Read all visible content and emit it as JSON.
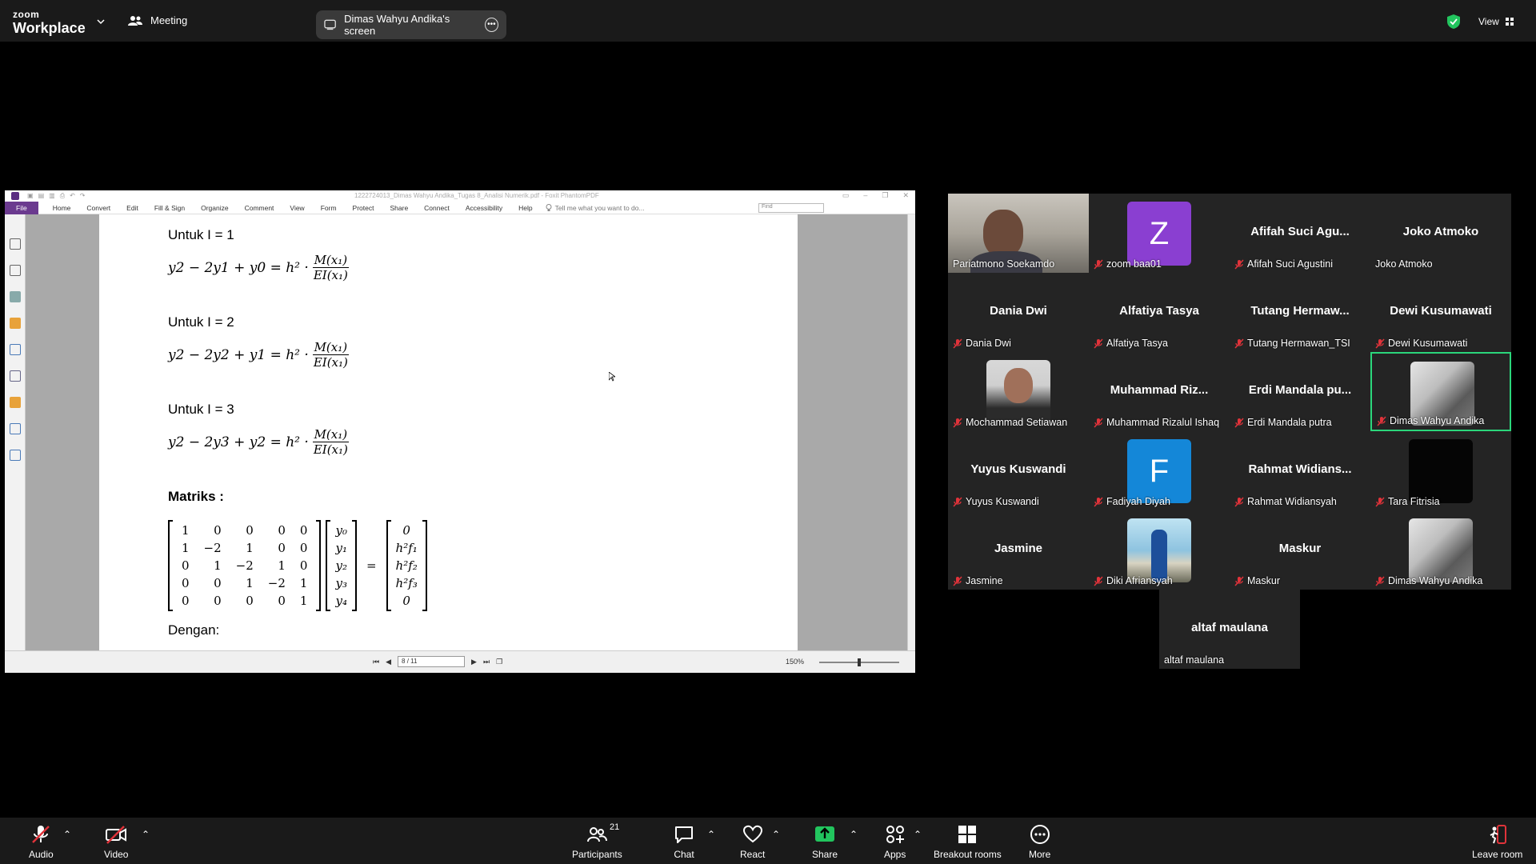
{
  "app": {
    "brand_small": "zoom",
    "brand_big": "Workplace",
    "meeting_label": "Meeting",
    "share_pill": "Dimas Wahyu Andika's screen",
    "view_label": "View"
  },
  "pdf": {
    "window_title": "1222724013_Dimas Wahyu Andika_Tugas 8_Analisi Numerik.pdf - Foxit PhantomPDF",
    "menus": [
      "File",
      "Home",
      "Convert",
      "Edit",
      "Fill & Sign",
      "Organize",
      "Comment",
      "View",
      "Form",
      "Protect",
      "Share",
      "Connect",
      "Accessibility",
      "Help"
    ],
    "tell_me": "Tell me what you want to do...",
    "find_placeholder": "Find",
    "page_indicator": "8 / 11",
    "zoom": "150%",
    "content": {
      "h1": "Untuk I = 1",
      "eq1_lhs": "y2 − 2y1 + y0 = h² ·",
      "h2": "Untuk I = 2",
      "eq2_lhs": "y2 − 2y2 + y1 = h² ·",
      "h3": "Untuk I = 3",
      "eq3_lhs": "y2 − 2y3 + y2 = h² ·",
      "frac_num": "M(x₁)",
      "frac_den": "EI(x₁)",
      "matrix_title": "Matriks :",
      "matrix_A": [
        "1",
        "0",
        "0",
        "0",
        "0",
        "1",
        "−2",
        "1",
        "0",
        "0",
        "0",
        "1",
        "−2",
        "1",
        "0",
        "0",
        "0",
        "1",
        "−2",
        "1",
        "0",
        "0",
        "0",
        "0",
        "1"
      ],
      "vector_y": [
        "y₀",
        "y₁",
        "y₂",
        "y₃",
        "y₄"
      ],
      "equals": "=",
      "vector_rhs": [
        "0",
        "h²f₁",
        "h²f₂",
        "h²f₃",
        "0"
      ],
      "footer_text": "Dengan:"
    }
  },
  "participants": [
    {
      "display": "",
      "label": "Pariatmono Soekamdo",
      "muted": false,
      "kind": "video"
    },
    {
      "display": "Z",
      "label": "zoom baa01",
      "muted": true,
      "kind": "avatar",
      "color": "#8a3fd1"
    },
    {
      "display": "Afifah  Suci  Agu...",
      "label": "Afifah Suci Agustini",
      "muted": true,
      "kind": "name"
    },
    {
      "display": "Joko Atmoko",
      "label": "Joko Atmoko",
      "muted": false,
      "kind": "name"
    },
    {
      "display": "Dania Dwi",
      "label": "Dania Dwi",
      "muted": true,
      "kind": "name"
    },
    {
      "display": "Alfatiya Tasya",
      "label": "Alfatiya Tasya",
      "muted": true,
      "kind": "name"
    },
    {
      "display": "Tutang  Hermaw...",
      "label": "Tutang Hermawan_TSI",
      "muted": true,
      "kind": "name"
    },
    {
      "display": "Dewi Kusumawati",
      "label": "Dewi Kusumawati",
      "muted": true,
      "kind": "name"
    },
    {
      "display": "",
      "label": "Mochammad Setiawan",
      "muted": true,
      "kind": "photo-person"
    },
    {
      "display": "Muhammad  Riz...",
      "label": "Muhammad Rizalul Ishaq",
      "muted": true,
      "kind": "name"
    },
    {
      "display": "Erdi  Mandala  pu...",
      "label": "Erdi Mandala putra",
      "muted": true,
      "kind": "name"
    },
    {
      "display": "",
      "label": "Dimas Wahyu Andika",
      "muted": true,
      "kind": "photo-room",
      "active": true
    },
    {
      "display": "Yuyus Kuswandi",
      "label": "Yuyus Kuswandi",
      "muted": true,
      "kind": "name"
    },
    {
      "display": "F",
      "label": "Fadiyah Diyah",
      "muted": true,
      "kind": "avatar",
      "color": "#1487d8"
    },
    {
      "display": "Rahmat  Widians...",
      "label": "Rahmat Widiansyah",
      "muted": true,
      "kind": "name"
    },
    {
      "display": "",
      "label": "Tara Fitrisia",
      "muted": true,
      "kind": "photo-dark"
    },
    {
      "display": "Jasmine",
      "label": "Jasmine",
      "muted": true,
      "kind": "name"
    },
    {
      "display": "",
      "label": "Diki Afriansyah",
      "muted": true,
      "kind": "photo-outdoor"
    },
    {
      "display": "Maskur",
      "label": "Maskur",
      "muted": true,
      "kind": "name"
    },
    {
      "display": "",
      "label": "Dimas Wahyu Andika",
      "muted": true,
      "kind": "photo-room"
    },
    {
      "display": "altaf maulana",
      "label": "altaf maulana",
      "muted": false,
      "kind": "name"
    }
  ],
  "toolbar": {
    "audio": "Audio",
    "video": "Video",
    "participants": "Participants",
    "participants_count": "21",
    "chat": "Chat",
    "react": "React",
    "share": "Share",
    "apps": "Apps",
    "breakout": "Breakout rooms",
    "more": "More",
    "leave": "Leave room"
  },
  "colors": {
    "accent_green": "#2bd67b",
    "share_green": "#22c55e",
    "muted_red": "#e0333a",
    "foxit_purple": "#6b3a8f"
  }
}
